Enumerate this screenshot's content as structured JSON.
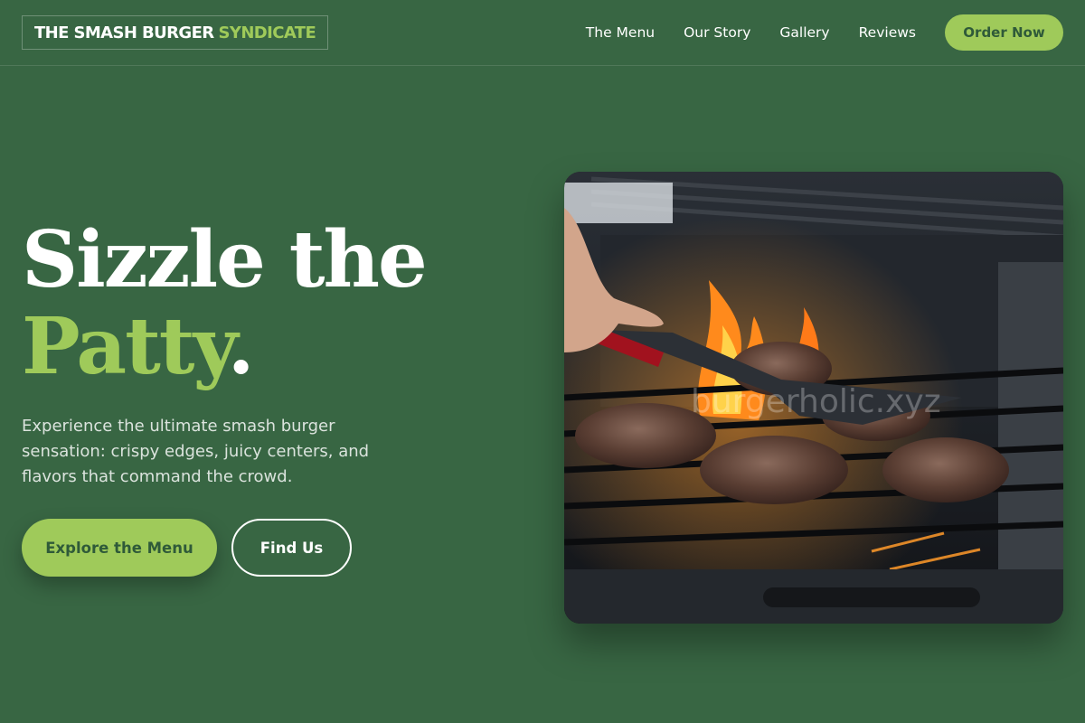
{
  "header": {
    "logo_main": "THE SMASH BURGER",
    "logo_accent": "SYNDICATE",
    "nav": [
      "The Menu",
      "Our Story",
      "Gallery",
      "Reviews"
    ],
    "cta_label": "Order Now"
  },
  "hero": {
    "headline_line1": "Sizzle the",
    "headline_line2": "Patty",
    "headline_punct": ".",
    "subtext": "Experience the ultimate smash burger sensation: crispy edges, juicy centers, and flavors that command the crowd.",
    "primary_button": "Explore the Menu",
    "secondary_button": "Find Us",
    "image_watermark": "burgerholic.xyz"
  },
  "colors": {
    "background": "#386643",
    "accent": "#9fca5a",
    "accent_text": "#2f5a39",
    "text": "#ffffff"
  }
}
